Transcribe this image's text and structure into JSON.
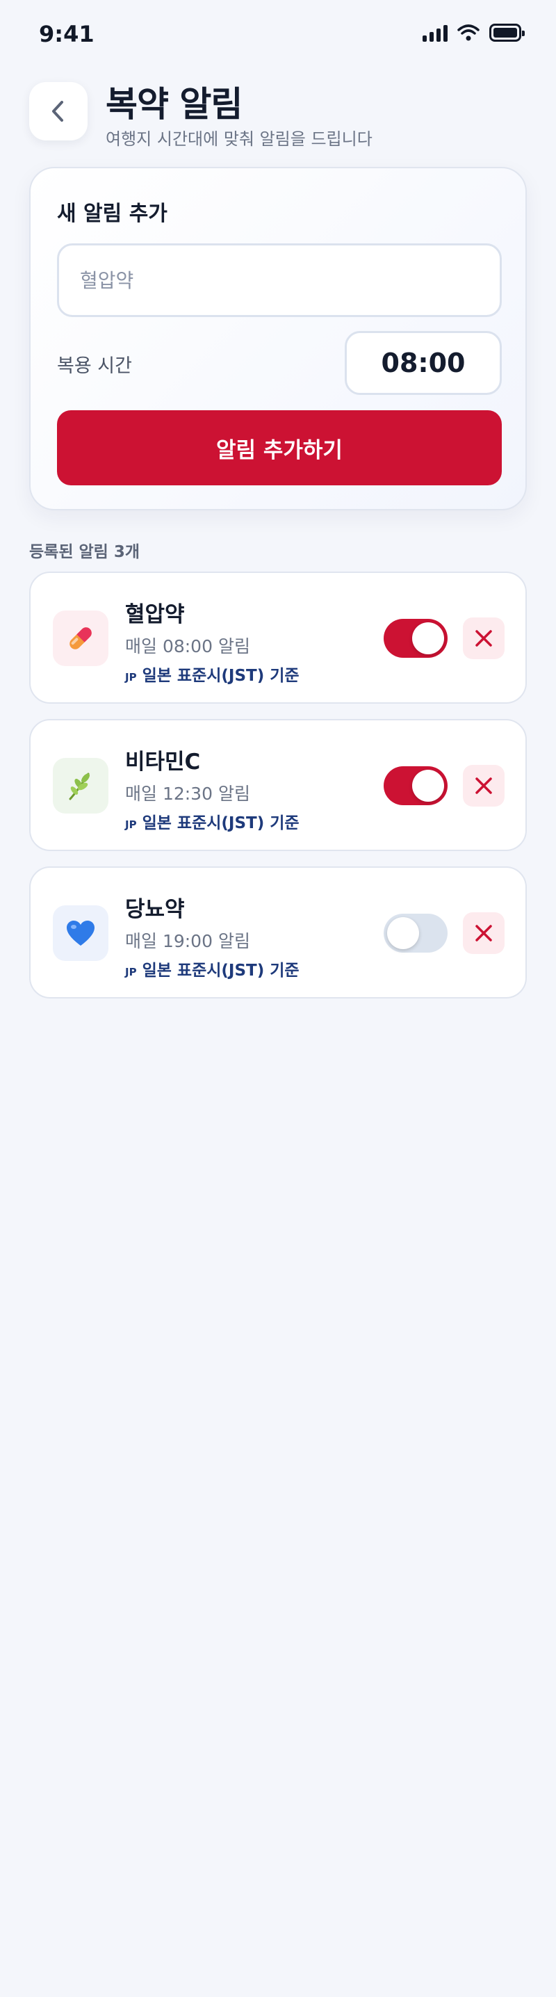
{
  "status_bar": {
    "time": "9:41",
    "icons": [
      "signal-icon",
      "wifi-icon",
      "battery-icon"
    ]
  },
  "header": {
    "title": "복약 알림",
    "subtitle": "여행지 시간대에 맞춰 알림을 드립니다",
    "back_icon": "chevron-left-icon"
  },
  "add_form": {
    "title": "새 알림 추가",
    "name_placeholder": "혈압약",
    "name_value": "",
    "time_label": "복용 시간",
    "time_value": "08:00",
    "submit_label": "알림 추가하기"
  },
  "list": {
    "count_label": "등록된 알림 3개",
    "items": [
      {
        "name": "혈압약",
        "time_text": "매일 08:00 알림",
        "flag": "JP",
        "timezone_text": "일본 표준시(JST) 기준",
        "enabled": true,
        "icon": "pill-icon",
        "icon_bg": "#fdeef1"
      },
      {
        "name": "비타민C",
        "time_text": "매일 12:30 알림",
        "flag": "JP",
        "timezone_text": "일본 표준시(JST) 기준",
        "enabled": true,
        "icon": "herb-icon",
        "icon_bg": "#eef6ec"
      },
      {
        "name": "당뇨약",
        "time_text": "매일 19:00 알림",
        "flag": "JP",
        "timezone_text": "일본 표준시(JST) 기준",
        "enabled": false,
        "icon": "blue-heart-icon",
        "icon_bg": "#edf2fc"
      }
    ]
  },
  "colors": {
    "accent": "#cc1233",
    "background": "#f4f6fb",
    "toggle_off": "#dbe3ee",
    "timezone_text": "#1e3a7b"
  }
}
